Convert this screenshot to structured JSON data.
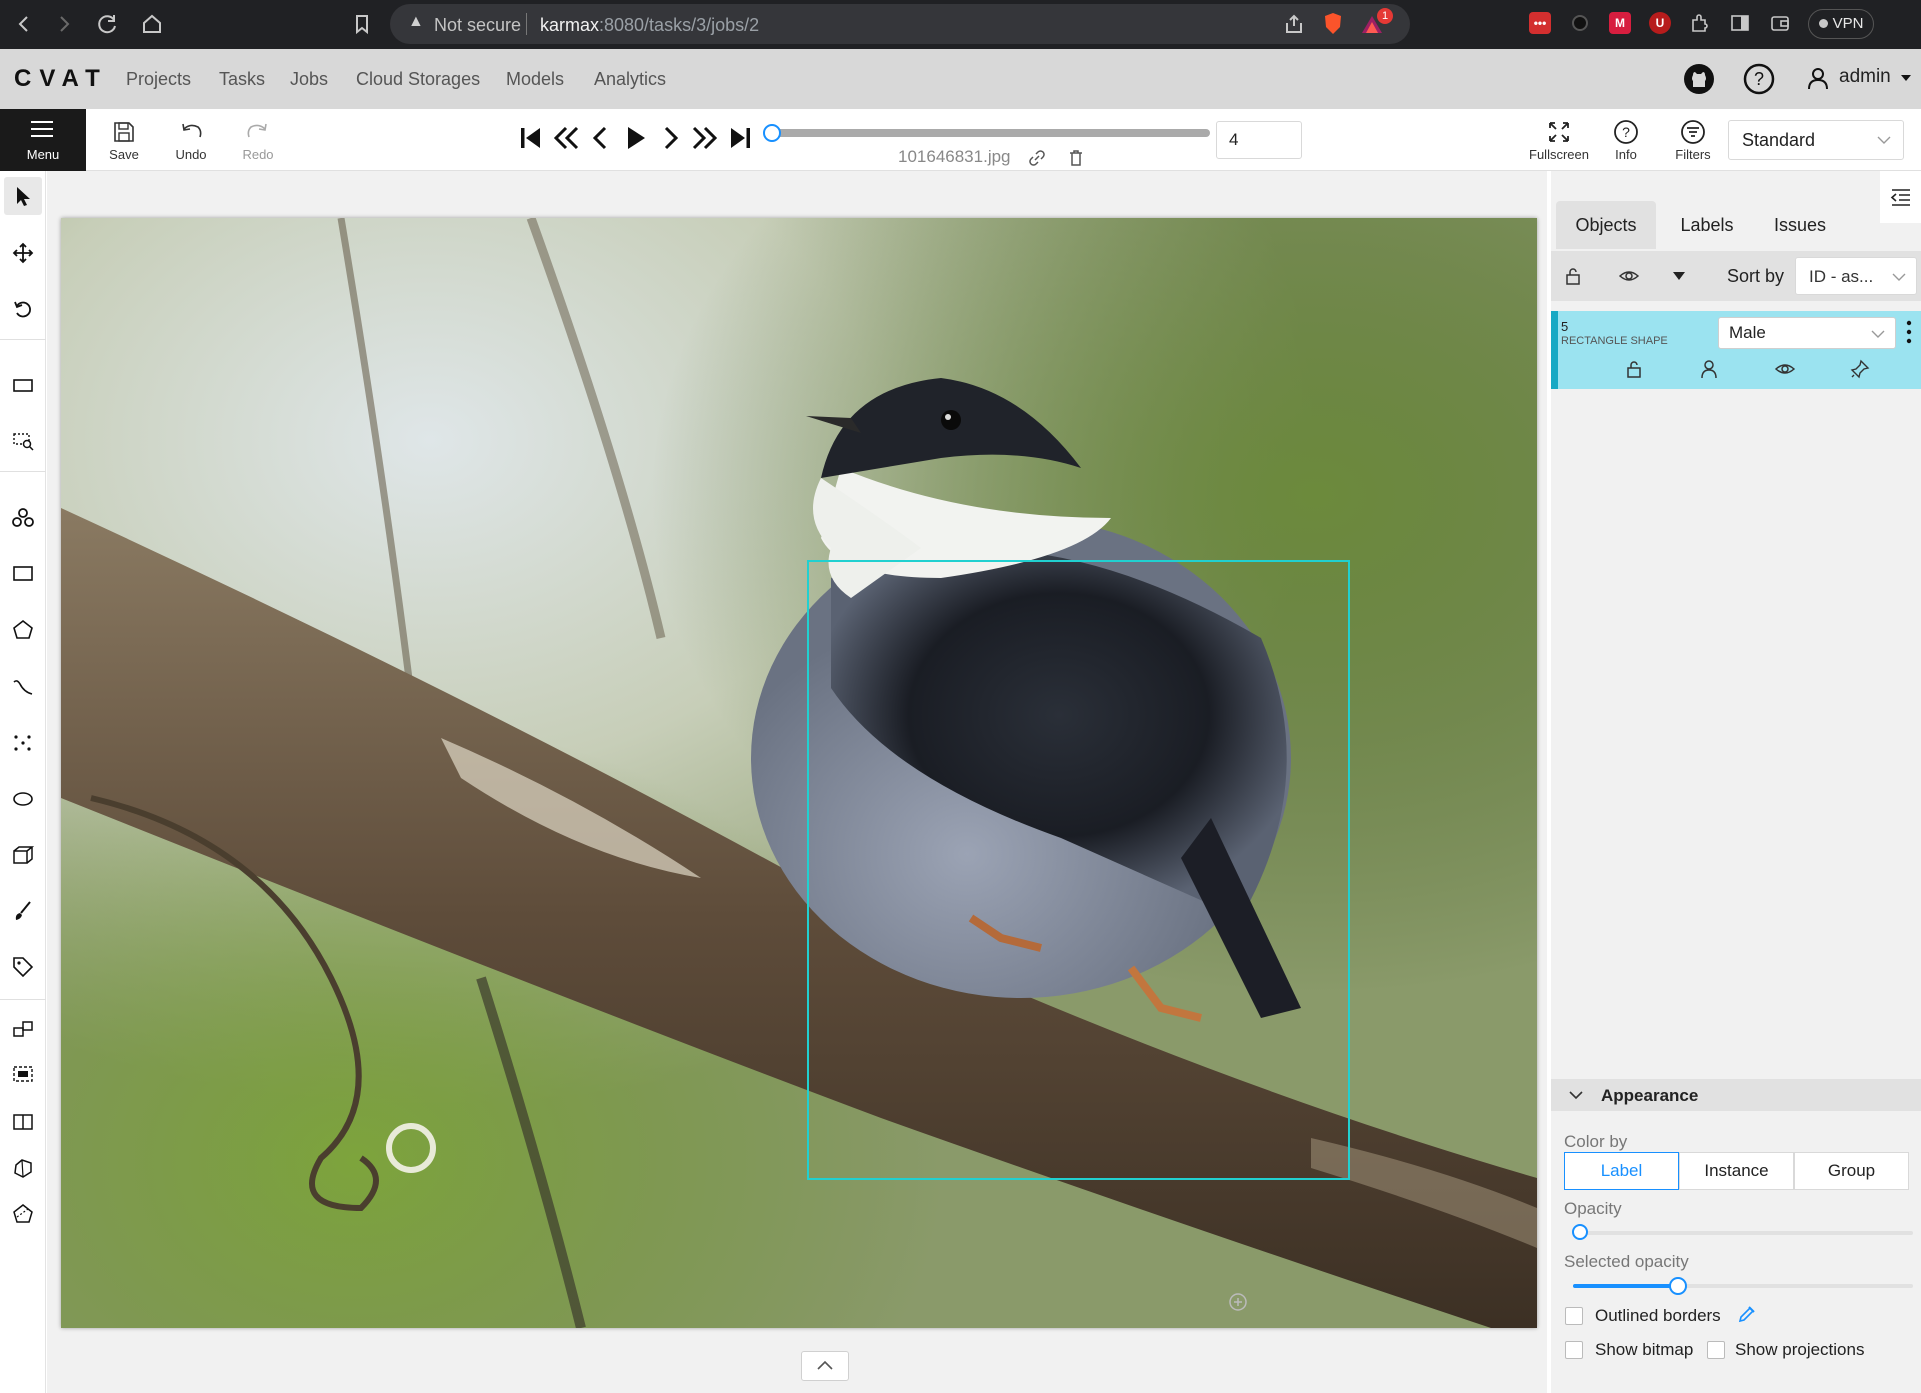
{
  "browser": {
    "security": "Not secure",
    "url_host": "karmax",
    "url_path": ":8080/tasks/3/jobs/2",
    "vpn_label": "VPN",
    "alert_count": "1"
  },
  "header": {
    "logo": "CVAT",
    "nav": [
      "Projects",
      "Tasks",
      "Jobs",
      "Cloud Storages",
      "Models",
      "Analytics"
    ],
    "user": "admin"
  },
  "toolbar": {
    "menu_label": "Menu",
    "save_label": "Save",
    "undo_label": "Undo",
    "redo_label": "Redo",
    "filename": "101646831.jpg",
    "frame_number": "4",
    "fullscreen_label": "Fullscreen",
    "info_label": "Info",
    "filters_label": "Filters",
    "workspace": "Standard",
    "frame_slider_position": 0.0
  },
  "sidebar": {
    "tabs": [
      "Objects",
      "Labels",
      "Issues"
    ],
    "active_tab": "Objects",
    "sort_label": "Sort by",
    "sort_value": "ID - as...",
    "objects": [
      {
        "id": "5",
        "type": "RECTANGLE SHAPE",
        "label": "Male",
        "color": "#21d0d0"
      }
    ],
    "appearance": {
      "title": "Appearance",
      "color_by_label": "Color by",
      "color_by_options": [
        "Label",
        "Instance",
        "Group"
      ],
      "color_by_selected": "Label",
      "opacity_label": "Opacity",
      "opacity_value": 0.0,
      "selected_opacity_label": "Selected opacity",
      "selected_opacity_value": 0.4,
      "outlined_borders_label": "Outlined borders",
      "show_bitmap_label": "Show bitmap",
      "show_projections_label": "Show projections"
    }
  },
  "colors": {
    "accent": "#1890ff",
    "object_highlight": "#9be3f0",
    "bbox": "#21d0d0"
  }
}
